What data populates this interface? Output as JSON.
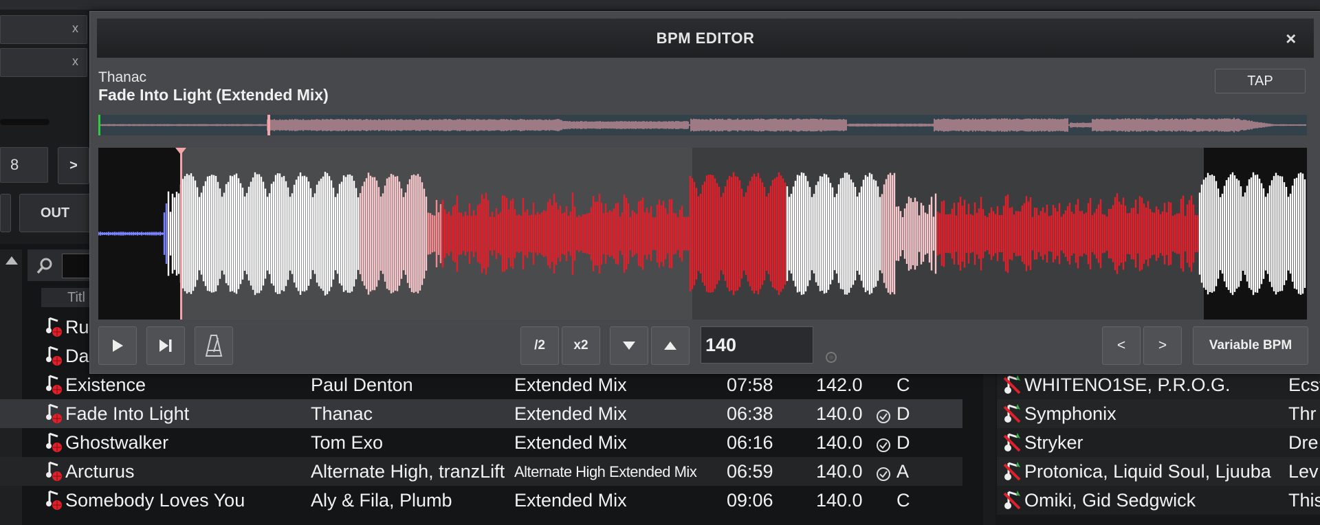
{
  "background": {
    "field_close_1": "x",
    "field_close_2": "x",
    "page_field": "8",
    "next_arrow": ">",
    "out_button": "OUT",
    "title_header": "Titl",
    "rows": [
      {
        "title": "Ru",
        "artist": "",
        "version": "",
        "length": "",
        "bpm": "",
        "key": "",
        "analyzed": false
      },
      {
        "title": "Da",
        "artist": "",
        "version": "",
        "length": "",
        "bpm": "",
        "key": "",
        "analyzed": false
      },
      {
        "title": "Existence",
        "artist": "Paul Denton",
        "version": "Extended Mix",
        "length": "07:58",
        "bpm": "142.0",
        "key": "C",
        "analyzed": false
      },
      {
        "title": "Fade Into Light",
        "artist": "Thanac",
        "version": "Extended Mix",
        "length": "06:38",
        "bpm": "140.0",
        "key": "D",
        "analyzed": true
      },
      {
        "title": "Ghostwalker",
        "artist": "Tom Exo",
        "version": "Extended Mix",
        "length": "06:16",
        "bpm": "140.0",
        "key": "D",
        "analyzed": true
      },
      {
        "title": "Arcturus",
        "artist": "Alternate High, tranzLift",
        "version": "Alternate High Extended Mix",
        "length": "06:59",
        "bpm": "140.0",
        "key": "A",
        "analyzed": true
      },
      {
        "title": "Somebody Loves You",
        "artist": "Aly & Fila, Plumb",
        "version": "Extended Mix",
        "length": "09:06",
        "bpm": "140.0",
        "key": "C",
        "analyzed": false
      }
    ],
    "right_rows": [
      {
        "artist": "WHITENO1SE, P.R.O.G.",
        "title": "Ecst"
      },
      {
        "artist": "Symphonix",
        "title": "Thr"
      },
      {
        "artist": "Stryker",
        "title": "Dre"
      },
      {
        "artist": "Protonica, Liquid Soul, Ljuuba",
        "title": "Lev"
      },
      {
        "artist": "Omiki, Gid Sedgwick",
        "title": "This"
      }
    ]
  },
  "dialog": {
    "title": "BPM EDITOR",
    "close_glyph": "×",
    "artist": "Thanac",
    "track_title": "Fade Into Light (Extended Mix)",
    "tap_label": "TAP",
    "half_label": "/2",
    "double_label": "x2",
    "bpm_value": "140",
    "prev_label": "<",
    "next_label": ">",
    "variable_bpm_label": "Variable BPM"
  },
  "colors": {
    "accent_red": "#e0202a",
    "wave_white": "#ffffff",
    "wave_blue": "#7b83ff",
    "marker_pink": "#f4a5a9"
  }
}
